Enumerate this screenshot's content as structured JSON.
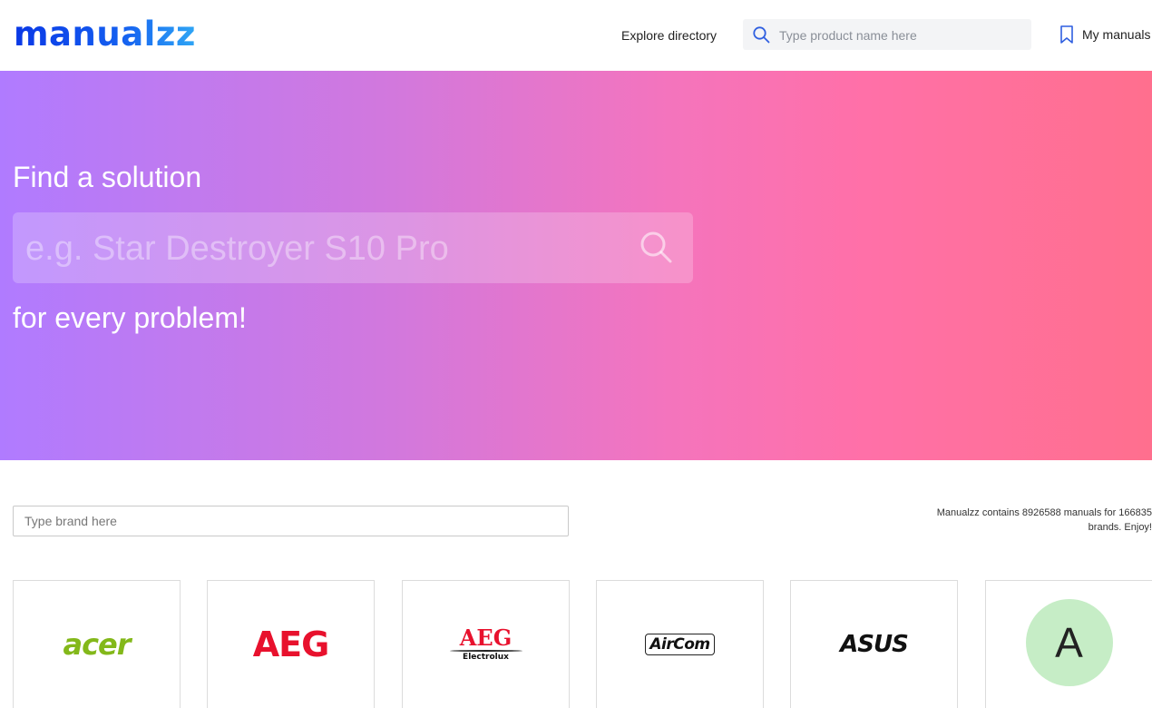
{
  "header": {
    "logo": "manualzz",
    "explore_label": "Explore directory",
    "search_placeholder": "Type product name here",
    "my_manuals_label": "My manuals"
  },
  "hero": {
    "title": "Find a solution",
    "search_placeholder": "e.g. Star Destroyer S10 Pro",
    "subtitle": "for every problem!"
  },
  "brand_filter": {
    "placeholder": "Type brand here"
  },
  "stats": {
    "text": "Manualzz contains 8926588 manuals for 166835 brands. Enjoy!"
  },
  "brands": [
    {
      "name": "acer",
      "logo_text": "acer",
      "color": "#83b81a"
    },
    {
      "name": "AEG",
      "logo_text": "AEG",
      "color": "#e8112d"
    },
    {
      "name": "AEG Electrolux",
      "logo_text": "AEG",
      "logo_sub": "Electrolux",
      "color": "#e8112d"
    },
    {
      "name": "AirCom",
      "logo_text": "AirCom",
      "color": "#111111"
    },
    {
      "name": "ASUS",
      "logo_text": "ASUS",
      "color": "#111111"
    },
    {
      "name": "A",
      "logo_text": "A",
      "color": "#c6edc6"
    }
  ],
  "colors": {
    "logo_gradient_start": "#0a38e6",
    "logo_gradient_end": "#2fa6f5",
    "hero_gradient_start": "#b07bff",
    "hero_gradient_end": "#ff6f8e"
  },
  "icons": {
    "top_search": "search-icon",
    "my_manuals": "bookmark-icon",
    "hero_search": "search-icon"
  }
}
